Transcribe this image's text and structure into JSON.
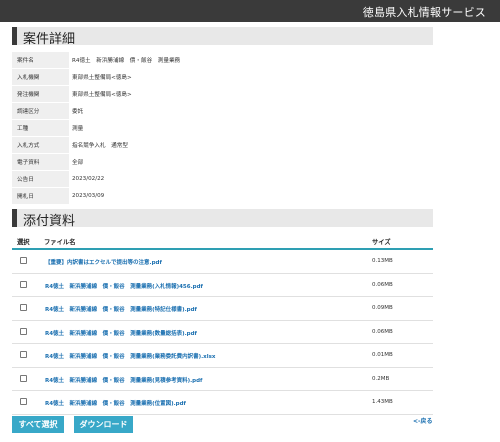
{
  "header": {
    "title": "徳島県入札情報サービス"
  },
  "detail": {
    "heading": "案件詳細",
    "rows": [
      {
        "label": "案件名",
        "value": "R4徳土　新浜勝浦線　價・飯谷　測量業務"
      },
      {
        "label": "入札機関",
        "value": "東部県土整備局<徳島>"
      },
      {
        "label": "発注機関",
        "value": "東部県土整備局<徳島>"
      },
      {
        "label": "調達区分",
        "value": "委託"
      },
      {
        "label": "工種",
        "value": "測量"
      },
      {
        "label": "入札方式",
        "value": "指名競争入札　通常型"
      },
      {
        "label": "電子資料",
        "value": "全部"
      },
      {
        "label": "公告日",
        "value": "2023/02/22"
      },
      {
        "label": "開札日",
        "value": "2023/03/09"
      }
    ]
  },
  "attachments": {
    "heading": "添付資料",
    "columns": {
      "select": "選択",
      "filename": "ファイル名",
      "size": "サイズ"
    },
    "files": [
      {
        "name": "【重要】内訳書はエクセルで提出等の注意.pdf",
        "size": "0.13MB"
      },
      {
        "name": "R4徳土　新浜勝浦線　價・飯谷　測量業務(入札情報)456.pdf",
        "size": "0.06MB"
      },
      {
        "name": "R4徳土　新浜勝浦線　價・飯谷　測量業務(特記仕様書).pdf",
        "size": "0.09MB"
      },
      {
        "name": "R4徳土　新浜勝浦線　價・飯谷　測量業務(数量総括表).pdf",
        "size": "0.06MB"
      },
      {
        "name": "R4徳土　新浜勝浦線　價・飯谷　測量業務(業務委託費内訳書).xlsx",
        "size": "0.01MB"
      },
      {
        "name": "R4徳土　新浜勝浦線　價・飯谷　測量業務(見積参考資料).pdf",
        "size": "0.2MB"
      },
      {
        "name": "R4徳土　新浜勝浦線　價・飯谷　測量業務(位置図).pdf",
        "size": "1.43MB"
      }
    ]
  },
  "actions": {
    "select_all": "すべて選択",
    "download": "ダウンロード",
    "back": "<-戻る"
  },
  "colors": {
    "accent": "#2e9fb3",
    "button": "#38a8c8",
    "link": "#1a6fb0",
    "header_bg": "#3a3a3a"
  }
}
